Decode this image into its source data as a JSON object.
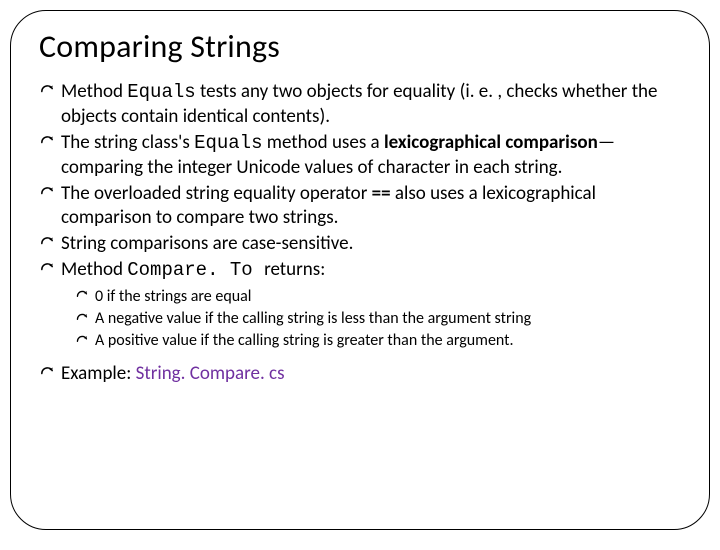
{
  "title": "Comparing Strings",
  "bullets": {
    "b1": {
      "pre": "Method ",
      "code": "Equals",
      "post": " tests any two objects for equality (i. e. , checks whether the objects contain identical contents)."
    },
    "b2": {
      "pre": "The string class's ",
      "code": "Equals",
      "mid": " method uses a ",
      "bold": "lexicographical comparison",
      "post": "—comparing the integer Unicode values of character in each string."
    },
    "b3": {
      "pre": "The overloaded string equality operator ",
      "bold": "==",
      "post": " also uses a lexicographical comparison to compare two strings."
    },
    "b4": {
      "text": "String comparisons are case-sensitive."
    },
    "b5": {
      "pre": "Method ",
      "code": " Compare. To ",
      "post": " returns:"
    },
    "sub": {
      "s1": "0 if the strings are equal",
      "s2": "A negative value if the calling string is less than the argument string",
      "s3": "A positive value if the calling string is greater than the argument."
    },
    "b6": {
      "pre": "Example: ",
      "link": "String. Compare. cs"
    }
  }
}
